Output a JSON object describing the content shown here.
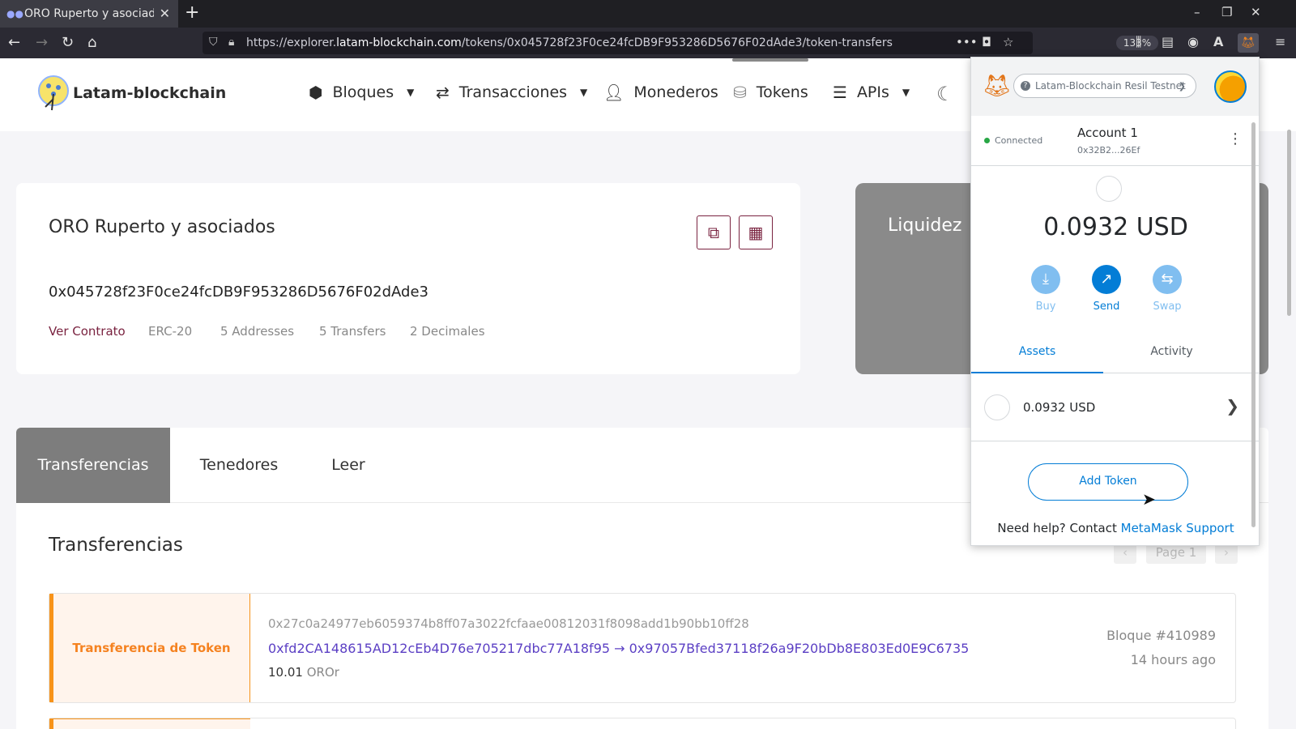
{
  "browser": {
    "tab_title": "ORO Ruperto y asociados",
    "url_prefix": "https://explorer.",
    "url_host": "latam-blockchain.com",
    "url_path": "/tokens/0x045728f23F0ce24fcDB9F953286D5676F02dAde3/token-transfers",
    "zoom": "133%"
  },
  "site": {
    "brand": "Latam-blockchain",
    "menu": {
      "blocks": "Bloques",
      "transactions": "Transacciones",
      "wallets": "Monederos",
      "tokens": "Tokens",
      "apis": "APIs"
    }
  },
  "token": {
    "name": "ORO Ruperto y asociados",
    "address": "0x045728f23F0ce24fcDB9F953286D5676F02dAde3",
    "view_contract": "Ver Contrato",
    "standard": "ERC-20",
    "addresses": "5 Addresses",
    "transfers": "5 Transfers",
    "decimals": "2 Decimales"
  },
  "liquidity": {
    "title": "Liquidez"
  },
  "tabs": {
    "transfers": "Transferencias",
    "holders": "Tenedores",
    "read": "Leer"
  },
  "transfers_section": {
    "title": "Transferencias",
    "page": "Page 1",
    "items": [
      {
        "type": "Transferencia de Token",
        "hash": "0x27c0a24977eb6059374b8ff07a3022fcfaae00812031f8098add1b90bb10ff28",
        "addresses": "0xfd2CA148615AD12cEb4D76e705217dbc77A18f95 → 0x97057Bfed37118f26a9F20bDb8E803Ed0E9C6735",
        "amount": "10.01",
        "unit": "OROr",
        "block": "Bloque #410989",
        "time": "14 hours ago"
      }
    ]
  },
  "metamask": {
    "network": "Latam-Blockchain Resil Testnet",
    "connected": "Connected",
    "account_name": "Account 1",
    "account_address": "0x32B2...26Ef",
    "balance": "0.0932 USD",
    "buy": "Buy",
    "send": "Send",
    "swap": "Swap",
    "tab_assets": "Assets",
    "tab_activity": "Activity",
    "asset_value": "0.0932 USD",
    "add_token": "Add Token",
    "help_prefix": "Need help? Contact ",
    "help_link": "MetaMask Support"
  },
  "colors": {
    "accent": "#7a2340",
    "mm_blue": "#037dd6",
    "transfer_orange": "#f7931a"
  }
}
